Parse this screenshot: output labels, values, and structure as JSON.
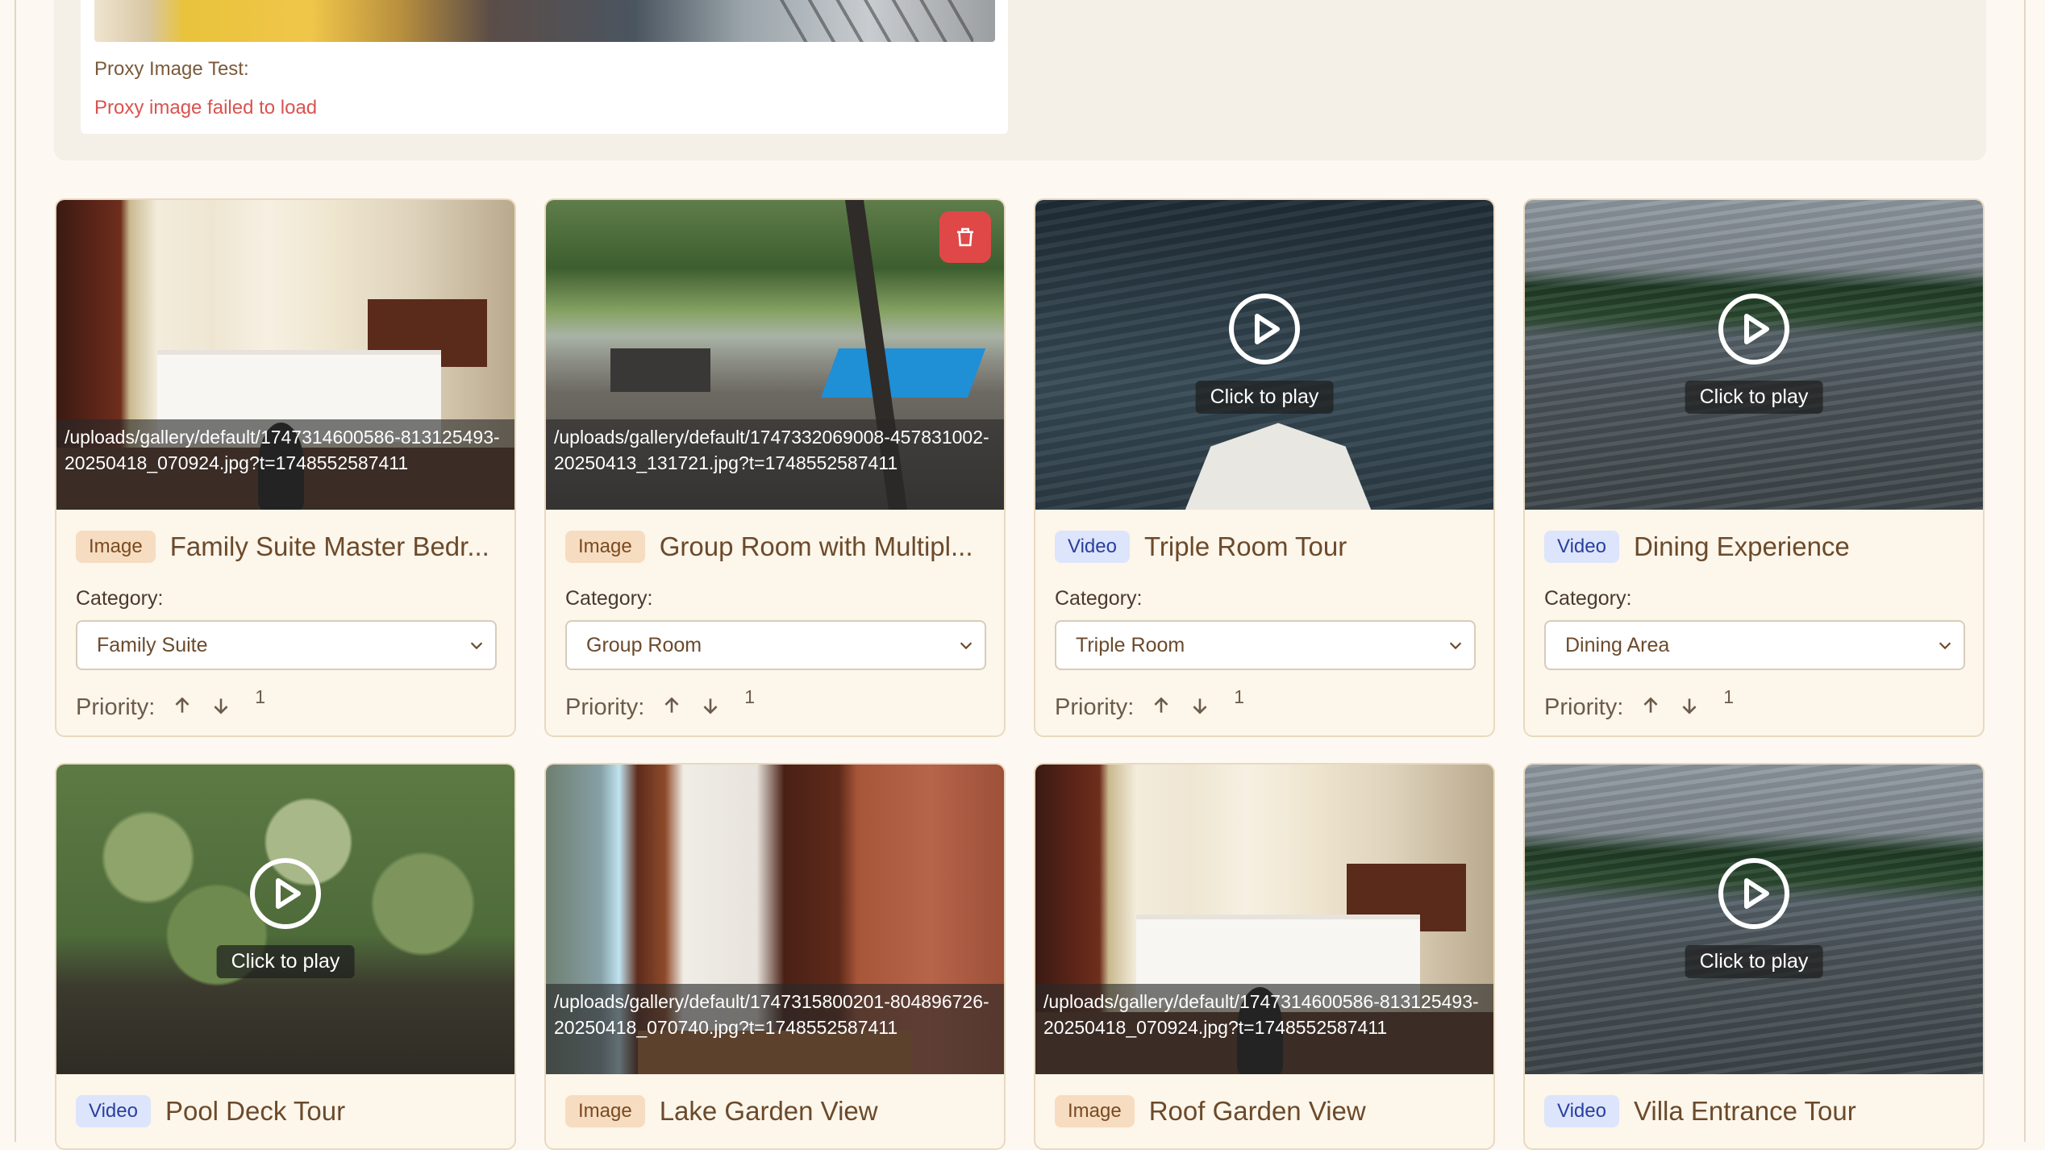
{
  "proxy_test": {
    "label": "Proxy Image Test:",
    "error": "Proxy image failed to load"
  },
  "labels": {
    "category": "Category:",
    "priority": "Priority:",
    "click_to_play": "Click to play"
  },
  "colors": {
    "page_bg": "#fdf9f2",
    "card_bg": "#fdf6ea",
    "delete_button": "#e04848",
    "badge_image_bg": "#f6dcc0",
    "badge_video_bg": "#dce5fb",
    "error_text": "#d9534f"
  },
  "icons": {
    "delete": "trash-icon",
    "play": "play-circle-icon",
    "dropdown": "chevron-down-icon",
    "priority_up": "arrow-up-icon",
    "priority_down": "arrow-down-icon"
  },
  "items": [
    {
      "type": "Image",
      "title": "Family Suite Master Bedr...",
      "category": "Family Suite",
      "priority": "1",
      "path": "/uploads/gallery/default/1747314600586-813125493-20250418_070924.jpg?t=1748552587411"
    },
    {
      "type": "Image",
      "title": "Group Room with Multipl...",
      "category": "Group Room",
      "priority": "1",
      "path": "/uploads/gallery/default/1747332069008-457831002-20250413_131721.jpg?t=1748552587411"
    },
    {
      "type": "Video",
      "title": "Triple Room Tour",
      "category": "Triple Room",
      "priority": "1"
    },
    {
      "type": "Video",
      "title": "Dining Experience",
      "category": "Dining Area",
      "priority": "1"
    },
    {
      "type": "Video",
      "title": "Pool Deck Tour"
    },
    {
      "type": "Image",
      "title": "Lake Garden View",
      "path": "/uploads/gallery/default/1747315800201-804896726-20250418_070740.jpg?t=1748552587411"
    },
    {
      "type": "Image",
      "title": "Roof Garden View",
      "path": "/uploads/gallery/default/1747314600586-813125493-20250418_070924.jpg?t=1748552587411"
    },
    {
      "type": "Video",
      "title": "Villa Entrance Tour"
    }
  ]
}
